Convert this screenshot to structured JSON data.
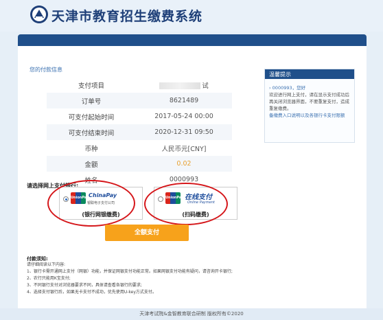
{
  "header": {
    "title": "天津市教育招生缴费系统"
  },
  "payment_info": {
    "section_title": "您的付款信息",
    "rows": [
      {
        "label": "支付项目",
        "value": "试",
        "masked": true
      },
      {
        "label": "订单号",
        "value": "8621489"
      },
      {
        "label": "可支付起始时间",
        "value": "2017-05-24 00:00"
      },
      {
        "label": "可支付结束时间",
        "value": "2020-12-31 09:50"
      },
      {
        "label": "币种",
        "value": "人民币元[CNY]"
      },
      {
        "label": "金额",
        "value": "0.02",
        "highlight": "#e8a02f"
      },
      {
        "label": "姓名",
        "value": "0000993"
      }
    ]
  },
  "tips": {
    "title": "温馨提示",
    "greeting": "0000993，您好",
    "body": "欢迎进行网上支付，请在显示支付成功后再关闭浏览器界面，不要重复支付，造成重复缴费。",
    "link": "备缴费入口说明以及各银行卡支付限额"
  },
  "payment_select": {
    "label": "请选择网上支付银行:",
    "options": [
      {
        "brand": "ChinaPay",
        "sub": "银联电子支付公司",
        "caption": "(银行网银缴费)",
        "checked": true
      },
      {
        "brand": "在线支付",
        "sub": "Online Payment",
        "caption": "(扫码缴费)",
        "checked": false
      }
    ],
    "unionpay_text": "UnionPay银联"
  },
  "confirm_button": "全额支付",
  "notes": {
    "title": "付款须知:",
    "items": [
      "请仔细阅读以下内容:",
      "1、银行卡需开通网上支付（网银）功能，并保证网银支付功能正常。如果网银支付功能有疑问，请咨询开卡银行;",
      "2、农行只能用K宝支付;",
      "3、不同银行支付对浏览器要求不同，具体请查看各银行的要求;",
      "4、选择支付银行后，如果无卡支付不成功，优先使用U-key方式支付。"
    ]
  },
  "footer": "天津考试院&金智教育联合研制   版权所有©2020",
  "colors": {
    "primary": "#1f4f8a",
    "accent": "#f7a21b",
    "annotation": "#d5161a"
  }
}
